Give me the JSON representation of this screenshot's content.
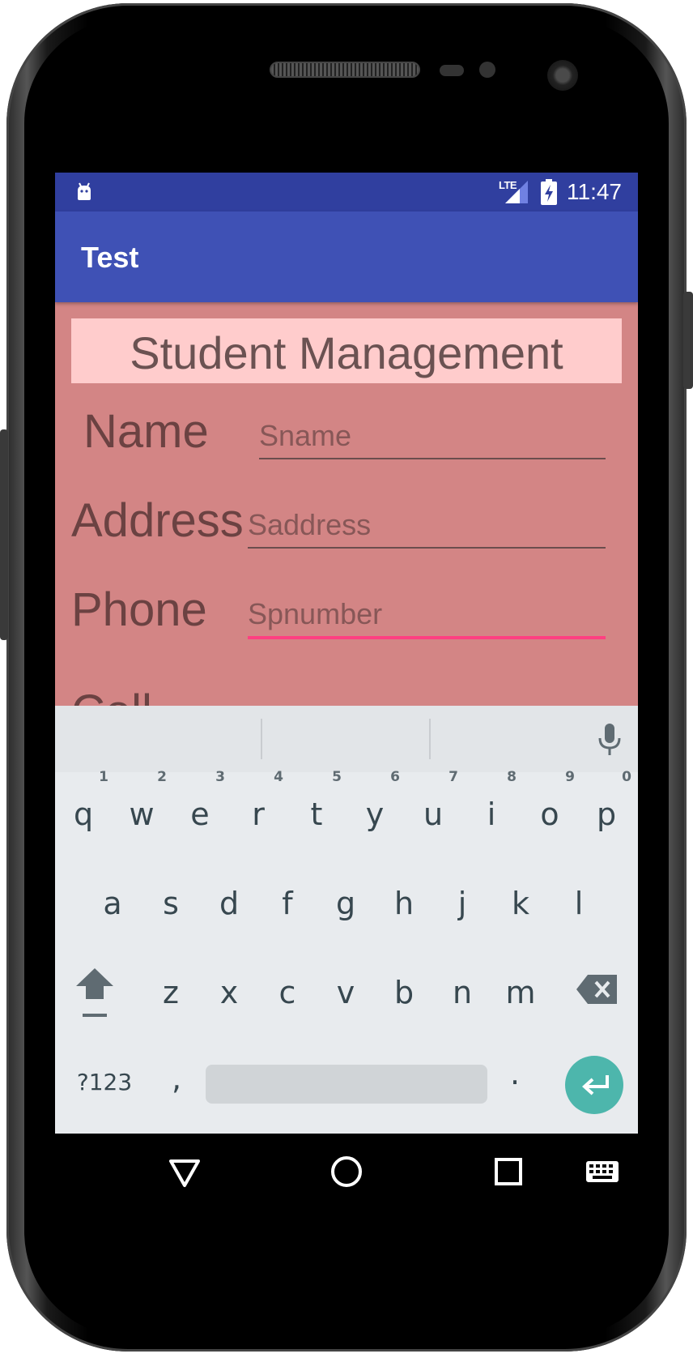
{
  "status_bar": {
    "network": "LTE",
    "time": "11:47"
  },
  "app_bar": {
    "title": "Test"
  },
  "form": {
    "heading": "Student Management",
    "name_label": "Name",
    "name_placeholder": "Sname",
    "address_label": "Address",
    "address_placeholder": "Saddress",
    "phone_label": "Phone",
    "phone_placeholder": "Spnumber",
    "next_label_partial": "Coll"
  },
  "keyboard": {
    "row1": [
      {
        "key": "q",
        "hint": "1"
      },
      {
        "key": "w",
        "hint": "2"
      },
      {
        "key": "e",
        "hint": "3"
      },
      {
        "key": "r",
        "hint": "4"
      },
      {
        "key": "t",
        "hint": "5"
      },
      {
        "key": "y",
        "hint": "6"
      },
      {
        "key": "u",
        "hint": "7"
      },
      {
        "key": "i",
        "hint": "8"
      },
      {
        "key": "o",
        "hint": "9"
      },
      {
        "key": "p",
        "hint": "0"
      }
    ],
    "row2": [
      "a",
      "s",
      "d",
      "f",
      "g",
      "h",
      "j",
      "k",
      "l"
    ],
    "row3": [
      "z",
      "x",
      "c",
      "v",
      "b",
      "n",
      "m"
    ],
    "symbols_label": "?123",
    "comma": ",",
    "period": ".",
    "accent_color": "#4db6ac"
  },
  "colors": {
    "status_bar": "#303f9f",
    "app_bar": "#3f51b5",
    "content_bg": "#d38585",
    "heading_bg": "#ffcccc",
    "focus_underline": "#ff4081"
  }
}
